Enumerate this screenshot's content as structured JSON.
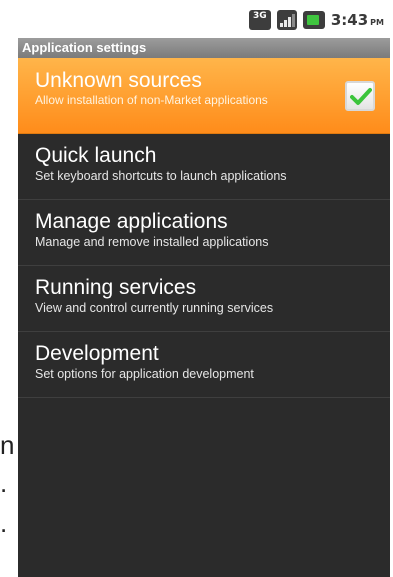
{
  "status_bar": {
    "network_icon": "3g-icon",
    "network_label": "3G",
    "signal_icon": "signal-icon",
    "battery_icon": "battery-icon",
    "time": "3:43",
    "ampm": "PM"
  },
  "header": {
    "title": "Application settings"
  },
  "items": [
    {
      "title": "Unknown sources",
      "summary": "Allow installation of non-Market applications",
      "checked": true
    },
    {
      "title": "Quick launch",
      "summary": "Set keyboard shortcuts to launch applications"
    },
    {
      "title": "Manage applications",
      "summary": "Manage and remove installed applications"
    },
    {
      "title": "Running services",
      "summary": "View and control currently running services"
    },
    {
      "title": "Development",
      "summary": "Set options for application development"
    }
  ],
  "edge_text": [
    "n",
    ".",
    "."
  ],
  "colors": {
    "selected_bg": "#ff9d2e",
    "list_bg": "#2b2b2b",
    "check_green": "#3cc43c"
  }
}
